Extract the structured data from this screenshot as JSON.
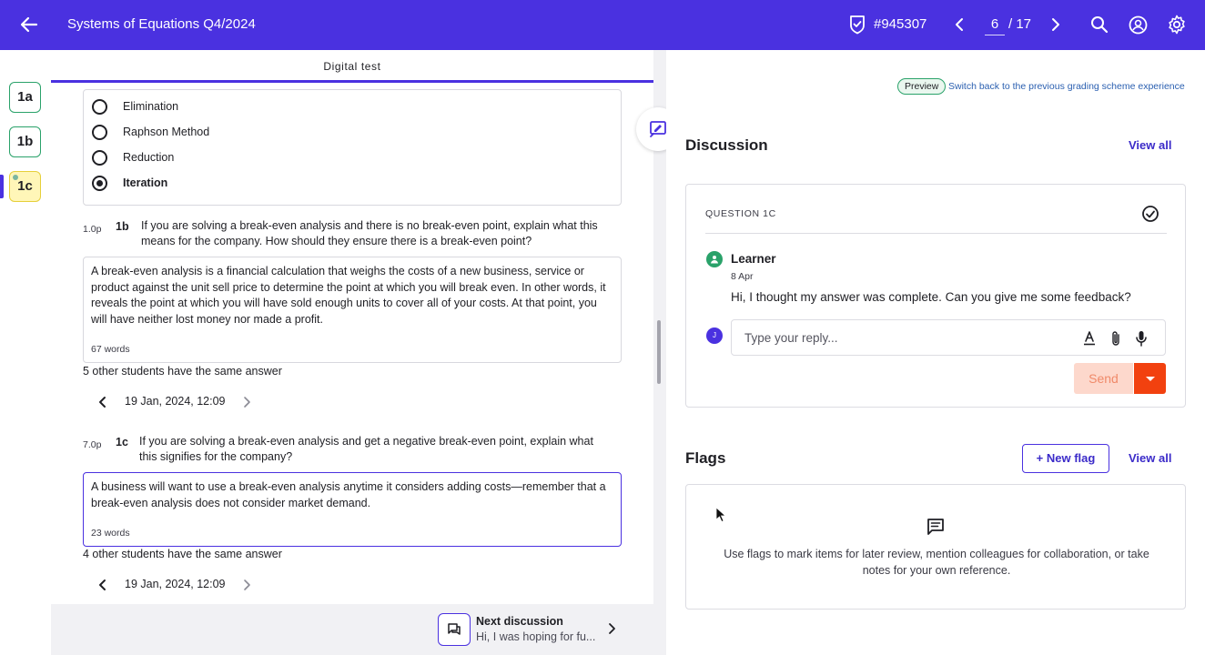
{
  "header": {
    "title": "Systems of Equations Q4/2024",
    "ticket": "#945307",
    "page_current": "6",
    "page_total": "/ 17"
  },
  "rail": {
    "questions": [
      {
        "label": "1a"
      },
      {
        "label": "1b"
      },
      {
        "label": "1c"
      }
    ]
  },
  "center": {
    "tab": "Digital test",
    "options": [
      {
        "label": "Elimination",
        "selected": false
      },
      {
        "label": "Raphson Method",
        "selected": false
      },
      {
        "label": "Reduction",
        "selected": false
      },
      {
        "label": "Iteration",
        "selected": true
      }
    ],
    "q1b": {
      "points": "1.0p",
      "number": "1b",
      "text": "If you are solving a break-even analysis and there is no break-even point, explain what this means for the company. How should they ensure there is a break-even point?",
      "answer": "A break-even analysis is a financial calculation that weighs the costs of a new business, service or product against the unit sell price to determine the point at which you will break even. In other words, it reveals the point at which you will have sold enough units to cover all of your costs. At that point, you will have neither lost money nor made a profit.",
      "word_count": "67 words",
      "same_answer": "5 other students have the same answer",
      "date": "19 Jan, 2024, 12:09"
    },
    "q1c": {
      "points": "7.0p",
      "number": "1c",
      "text": "If you are solving a break-even analysis and get a negative break-even point, explain what this signifies for the company?",
      "answer": "A business will want to use a break-even analysis anytime it considers adding costs—remember that a break-even analysis does not consider market demand.",
      "word_count": "23 words",
      "same_answer": "4 other students have the same answer",
      "date": "19 Jan, 2024, 12:09"
    },
    "next_discussion": {
      "title": "Next discussion",
      "preview": "Hi, I was hoping for fu..."
    }
  },
  "right": {
    "preview_badge": "Preview",
    "switch_link": "Switch back to the previous grading scheme experience",
    "discussion": {
      "heading": "Discussion",
      "view_all": "View all",
      "question_label": "QUESTION 1C",
      "author": "Learner",
      "date": "8 Apr",
      "message": "Hi, I thought my answer was complete. Can you give me some feedback?",
      "reply_avatar": "J",
      "reply_placeholder": "Type your reply...",
      "send_label": "Send"
    },
    "flags": {
      "heading": "Flags",
      "new_flag": "+ New flag",
      "view_all": "View all",
      "empty_text": "Use flags to mark items for later review, mention colleagues for collaboration, or take notes for your own reference."
    }
  },
  "colors": {
    "brand": "#4a31e0",
    "success": "#2aa26a",
    "send_accent": "#f2410f",
    "active_tab_bg": "#fff6b8"
  }
}
